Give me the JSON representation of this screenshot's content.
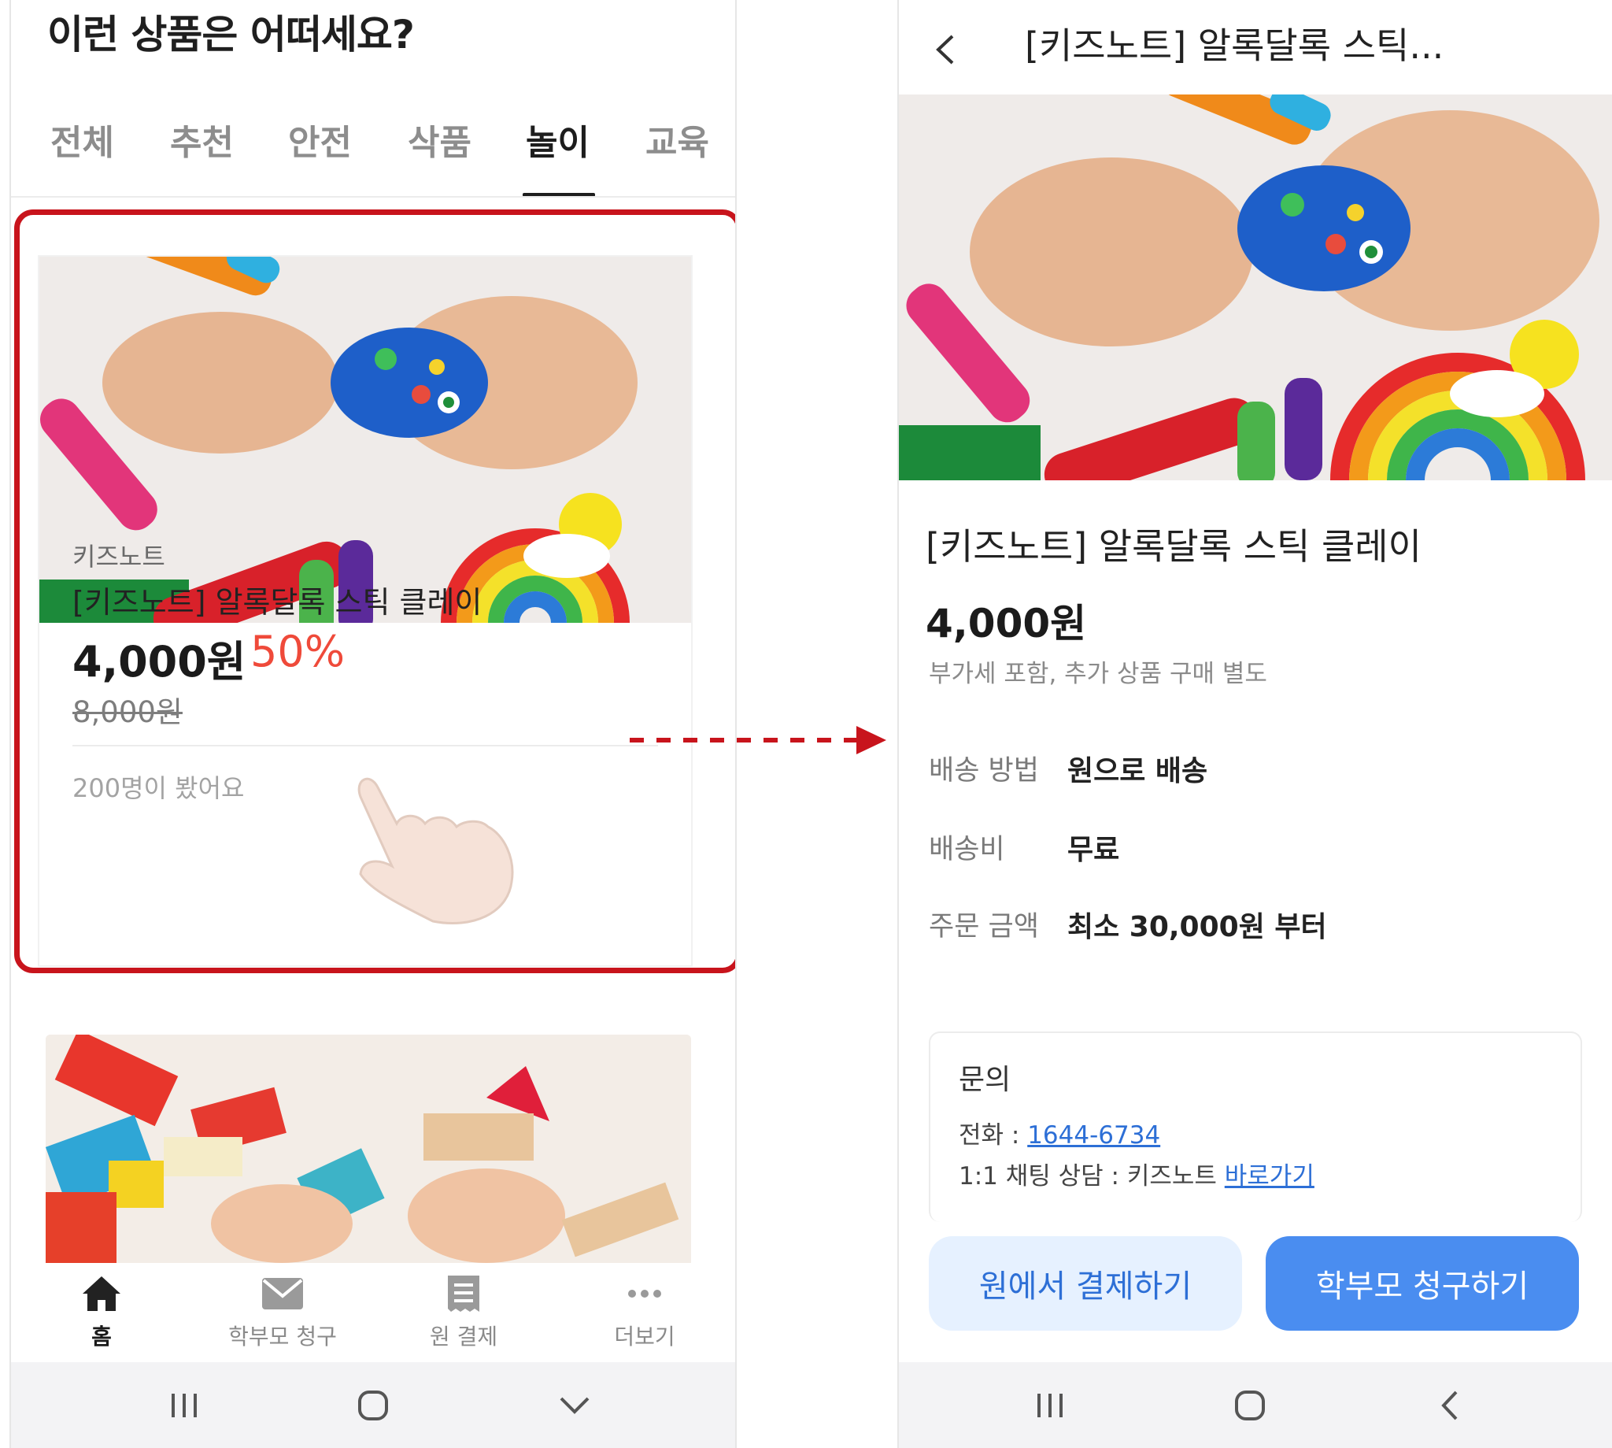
{
  "left": {
    "heading": "이런 상품은 어떠세요?",
    "tabs": [
      "전체",
      "추천",
      "안전",
      "삭품",
      "놀이",
      "교육"
    ],
    "active_tab": "놀이",
    "product": {
      "brand": "키즈노트",
      "title": "[키즈노트] 알록달록 스틱 클레이",
      "price": "4,000원",
      "discount": "50%",
      "original_price": "8,000원",
      "views": "200명이 봤어요"
    },
    "bottom_nav": [
      {
        "label": "홈",
        "icon": "home-icon"
      },
      {
        "label": "학부모 청구",
        "icon": "mail-icon"
      },
      {
        "label": "원 결제",
        "icon": "receipt-icon"
      },
      {
        "label": "더보기",
        "icon": "more-dots-icon"
      }
    ],
    "system_nav": [
      "recent-apps-icon",
      "home-circle-icon",
      "chevron-down-icon"
    ]
  },
  "right": {
    "header_title": "[키즈노트] 알록달록 스틱...",
    "product_title": "[키즈노트] 알록달록 스틱 클레이",
    "price": "4,000원",
    "vat_note": "부가세 포함, 추가 상품 구매 별도",
    "info": [
      {
        "label": "배송 방법",
        "value": "원으로 배송"
      },
      {
        "label": "배송비",
        "value": "무료"
      },
      {
        "label": "주문 금액",
        "value": "최소 30,000원 부터"
      }
    ],
    "inquiry": {
      "title": "문의",
      "phone_label": "전화 : ",
      "phone": "1644-6734",
      "chat_label": "1:1 채팅 상담 : 키즈노트 ",
      "chat_link": "바로가기"
    },
    "buttons": {
      "pay_at_center": "원에서 결제하기",
      "bill_parent": "학부모 청구하기"
    },
    "system_nav": [
      "recent-apps-icon",
      "home-circle-icon",
      "back-icon"
    ]
  },
  "colors": {
    "highlight": "#c8141c",
    "discount": "#ef4a3a",
    "primary_button": "#4a8df0",
    "light_button": "#e6f1ff",
    "link": "#2d6fd6"
  }
}
